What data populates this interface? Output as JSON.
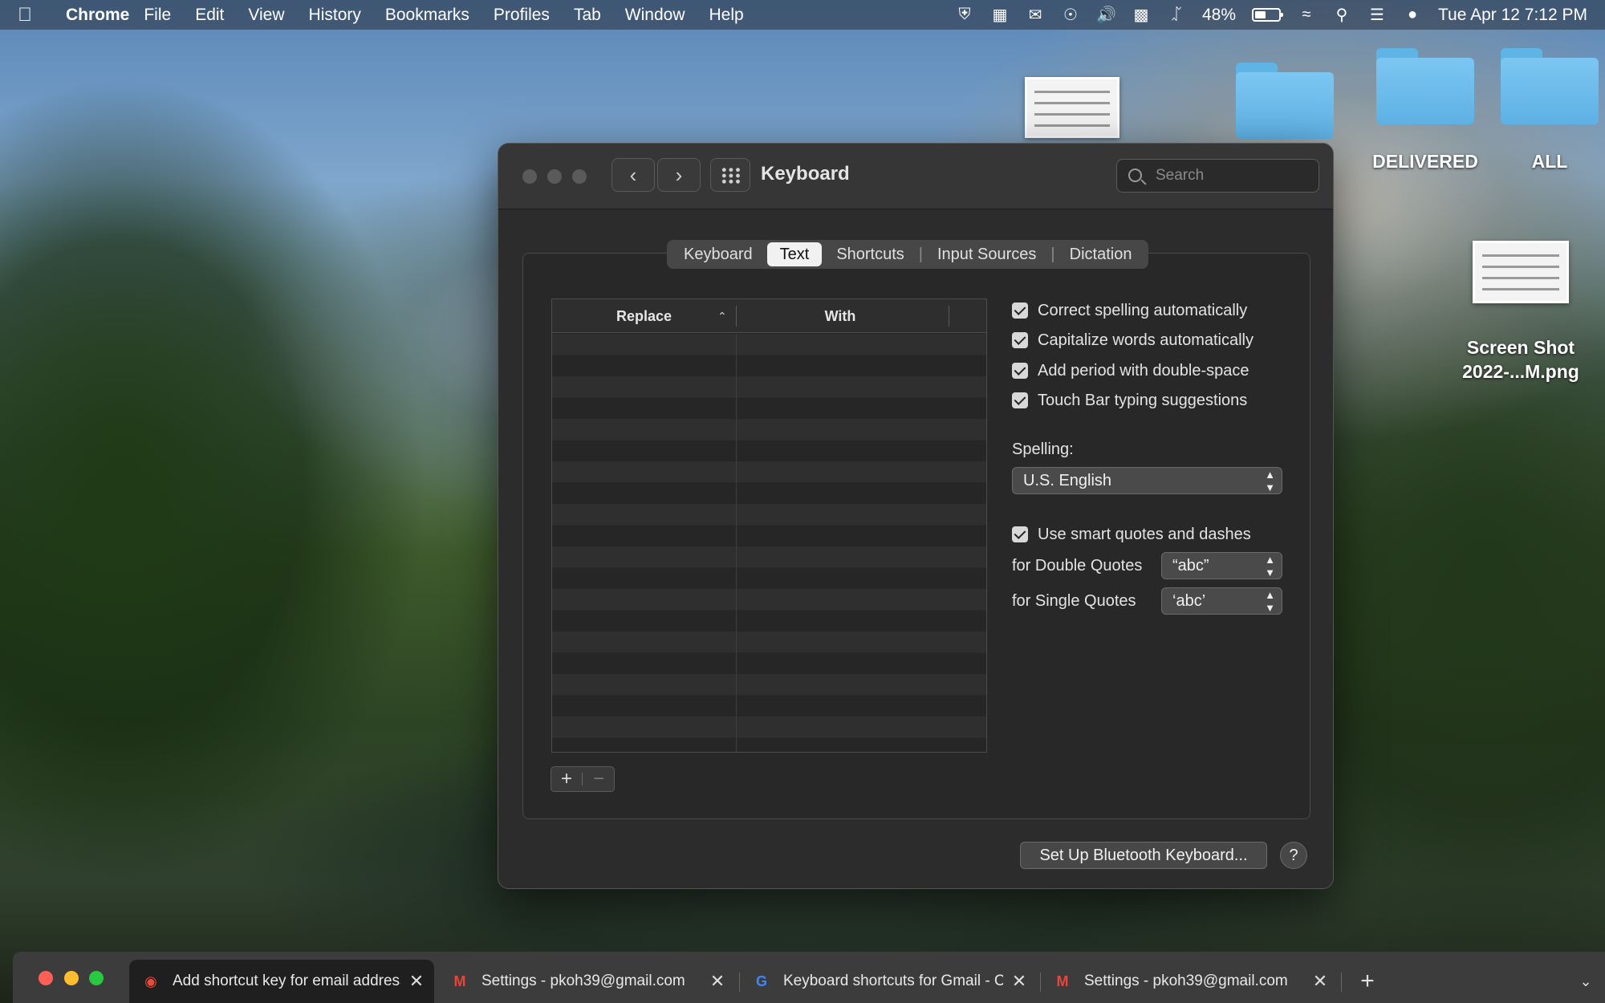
{
  "menubar": {
    "app_name": "Chrome",
    "items": [
      "File",
      "Edit",
      "View",
      "History",
      "Bookmarks",
      "Profiles",
      "Tab",
      "Window",
      "Help"
    ],
    "battery_percent": "48%",
    "battery_level": 0.48,
    "datetime": "Tue Apr 12  7:12 PM"
  },
  "desktop": {
    "folders": [
      {
        "label": ""
      },
      {
        "label": "DELIVERED"
      },
      {
        "label": "ALL"
      }
    ],
    "screenshot_label_line1": "Screen Shot",
    "screenshot_label_line2": "2022-...M.png"
  },
  "window": {
    "title": "Keyboard",
    "search_placeholder": "Search",
    "tabs": [
      "Keyboard",
      "Text",
      "Shortcuts",
      "Input Sources",
      "Dictation"
    ],
    "active_tab": "Text",
    "table": {
      "col_replace": "Replace",
      "col_with": "With"
    },
    "add_label": "+",
    "remove_label": "−",
    "options": {
      "correct_spelling": {
        "label": "Correct spelling automatically",
        "checked": true
      },
      "capitalize_words": {
        "label": "Capitalize words automatically",
        "checked": true
      },
      "add_period": {
        "label": "Add period with double-space",
        "checked": true
      },
      "touch_bar": {
        "label": "Touch Bar typing suggestions",
        "checked": true
      },
      "smart_quotes": {
        "label": "Use smart quotes and dashes",
        "checked": true
      }
    },
    "spelling_label": "Spelling:",
    "spelling_value": "U.S. English",
    "double_quotes_label": "for Double Quotes",
    "double_quotes_value": "“abc”",
    "single_quotes_label": "for Single Quotes",
    "single_quotes_value": "‘abc’",
    "bluetooth_button": "Set Up Bluetooth Keyboard...",
    "help_button": "?"
  },
  "chrome_tabs": [
    {
      "title": "Add shortcut key for email address",
      "favicon": "apple-support-icon"
    },
    {
      "title": "Settings - pkoh39@gmail.com",
      "favicon": "gmail-icon"
    },
    {
      "title": "Keyboard shortcuts for Gmail - Computer",
      "favicon": "google-icon"
    },
    {
      "title": "Settings - pkoh39@gmail.com",
      "favicon": "gmail-icon"
    }
  ],
  "colors": {
    "close": "#ff5f57",
    "minimize": "#febc2e",
    "zoom": "#28c840"
  }
}
